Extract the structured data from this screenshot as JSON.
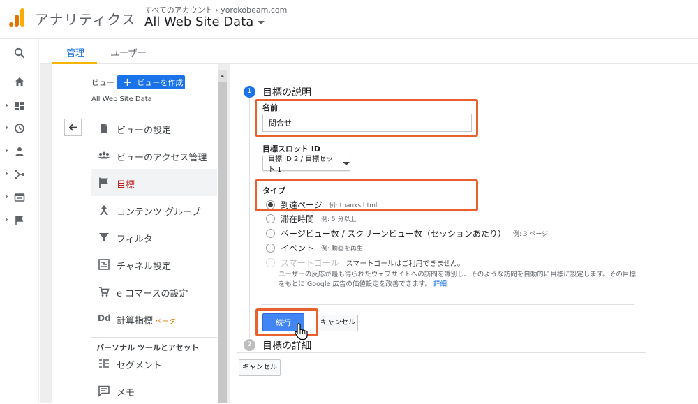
{
  "header": {
    "app_name": "アナリティクス",
    "account_crumb": "すべてのアカウント › yorokobeam.com",
    "property_title": "All Web Site Data"
  },
  "rail": {
    "icons": [
      "search-icon",
      "home-icon",
      "dashboard-icon",
      "clock-icon",
      "person-icon",
      "acquisition-icon",
      "behavior-icon",
      "flag-icon"
    ]
  },
  "tabs": [
    {
      "label": "管理",
      "active": true
    },
    {
      "label": "ユーザー",
      "active": false
    }
  ],
  "admin": {
    "view_label": "ビュー",
    "create_view_label": "ビューを作成",
    "view_name": "All Web Site Data",
    "menu": [
      {
        "label": "ビューの設定",
        "icon": "document-icon"
      },
      {
        "label": "ビューのアクセス管理",
        "icon": "people-icon"
      },
      {
        "label": "目標",
        "icon": "flag-icon",
        "active": true
      },
      {
        "label": "コンテンツ グループ",
        "icon": "content-group-icon"
      },
      {
        "label": "フィルタ",
        "icon": "filter-icon"
      },
      {
        "label": "チャネル設定",
        "icon": "channel-icon"
      },
      {
        "label": "e コマースの設定",
        "icon": "cart-icon"
      },
      {
        "label": "計算指標",
        "beta": "ベータ",
        "icon": "dd-icon"
      }
    ],
    "section_heading": "パーソナル ツールとアセット",
    "personal_menu": [
      {
        "label": "セグメント",
        "icon": "segment-icon"
      },
      {
        "label": "メモ",
        "icon": "memo-icon"
      }
    ]
  },
  "goal": {
    "step1_number": "1",
    "step1_title": "目標の説明",
    "name_label": "名前",
    "name_value": "問合せ",
    "slot_label": "目標スロット ID",
    "slot_value": "目標 ID 2 / 目標セット 1",
    "type_label": "タイプ",
    "types": [
      {
        "label": "到達ページ",
        "example": "例: thanks.html",
        "checked": true
      },
      {
        "label": "滞在時間",
        "example": "例: 5 分以上"
      },
      {
        "label": "ページビュー数 / スクリーンビュー数（セッションあたり）",
        "example": "例: 3 ページ"
      },
      {
        "label": "イベント",
        "example": "例: 動画を再生"
      },
      {
        "label": "スマートゴール",
        "note": "スマートゴールはご利用できません。",
        "disabled": true
      }
    ],
    "smart_desc": "ユーザーの反応が最も得られたウェブサイトへの訪問を識別し、そのような訪問を自動的に目標に設定します。その目標をもとに Google 広告の価値設定を改善できます。",
    "smart_link": "詳細",
    "continue_label": "続行",
    "cancel_label": "キャンセル",
    "step2_number": "2",
    "step2_title": "目標の詳細",
    "bottom_cancel_label": "キャンセル"
  }
}
